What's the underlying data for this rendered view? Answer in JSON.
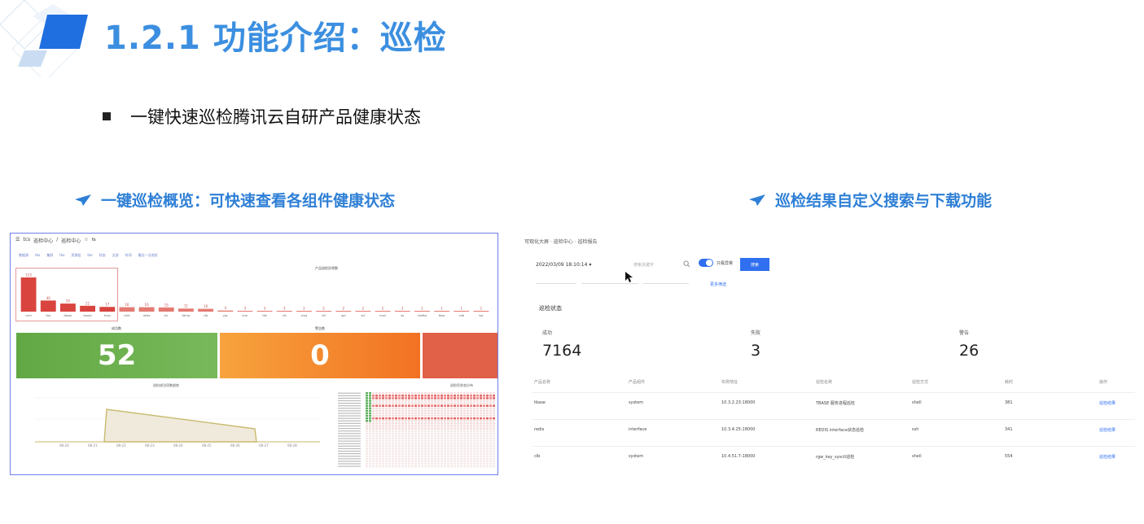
{
  "slide": {
    "title": "1.2.1 功能介绍：巡检",
    "bullet": "一键快速巡检腾讯云自研产品健康状态",
    "left_subtitle": "一键巡检概览：可快速查看各组件健康状态",
    "right_subtitle": "巡检结果自定义搜索与下载功能",
    "brand_color": "#3c8fe0"
  },
  "left_shot": {
    "nav": [
      "☰",
      "tcs",
      "巡检中心",
      "/",
      "巡检中心",
      "☆",
      "⇆"
    ],
    "filters": [
      "数据源",
      "tke",
      "集群",
      "tke",
      "资源组",
      "tke",
      "状态",
      "全部",
      "时间",
      "最近一次巡检"
    ],
    "bar_chart_title": "产品巡检异常数",
    "bars": [
      {
        "label": "cvm",
        "value": 123
      },
      {
        "label": "cbs",
        "value": 40
      },
      {
        "label": "tbase",
        "value": 29
      },
      {
        "label": "barad",
        "value": 21
      },
      {
        "label": "tceq",
        "value": 17
      },
      {
        "label": "ckfs",
        "value": 16
      },
      {
        "label": "redis",
        "value": 16
      },
      {
        "label": "tcr",
        "value": 15
      },
      {
        "label": "tdmq",
        "value": 11
      },
      {
        "label": "clb",
        "value": 10
      },
      {
        "label": "vpc",
        "value": 4
      },
      {
        "label": "tcm",
        "value": 3
      },
      {
        "label": "tke",
        "value": 3
      },
      {
        "label": "cfs",
        "value": 3
      },
      {
        "label": "cmq",
        "value": 2
      },
      {
        "label": "tsf",
        "value": 2
      },
      {
        "label": "api",
        "value": 2
      },
      {
        "label": "scf",
        "value": 2
      },
      {
        "label": "mon",
        "value": 2
      },
      {
        "label": "es",
        "value": 2
      },
      {
        "label": "ckafka",
        "value": 2
      },
      {
        "label": "tbos",
        "value": 1
      },
      {
        "label": "cdb",
        "value": 1
      },
      {
        "label": "tse",
        "value": 1
      }
    ],
    "tiles": [
      {
        "label": "成功数",
        "value": "52",
        "color": "#62a844"
      },
      {
        "label": "警告数",
        "value": "0",
        "color": "#f27223"
      },
      {
        "label": "失败数",
        "value": "",
        "color": "#e06048"
      }
    ],
    "line_chart_title": "巡检成功项数趋势",
    "grid_title": "巡检项状态分布"
  },
  "right_shot": {
    "breadcrumb": "可观化大屏 · 巡检中心 · 巡检报告",
    "date_value": "2022/03/09 18:10:14 ▾",
    "search_placeholder": "搜索关键字",
    "toggle_label": "只看异常",
    "search_button": "搜索",
    "more_link": "更多筛选",
    "section_title": "巡检状态",
    "stats": [
      {
        "label": "成功",
        "value": "7164"
      },
      {
        "label": "失败",
        "value": "3"
      },
      {
        "label": "警告",
        "value": "26"
      }
    ],
    "table": {
      "headers": [
        "产品名称",
        "产品组件",
        "实例地址",
        "巡检名称",
        "巡检方式",
        "耗时",
        "操作"
      ],
      "rows": [
        [
          "tbase",
          "system",
          "10.3.2.23:18000",
          "TBASE 服务进程巡检",
          "shell",
          "381",
          "巡检结果"
        ],
        [
          "redis",
          "interface",
          "10.3.4.25:18000",
          "REDIS interface状态巡检",
          "ssh",
          "341",
          "巡检结果"
        ],
        [
          "clb",
          "system",
          "10.4.51.7:18000",
          "rgw_key_sysctl巡检",
          "shell",
          "554",
          "巡检结果"
        ]
      ]
    }
  }
}
